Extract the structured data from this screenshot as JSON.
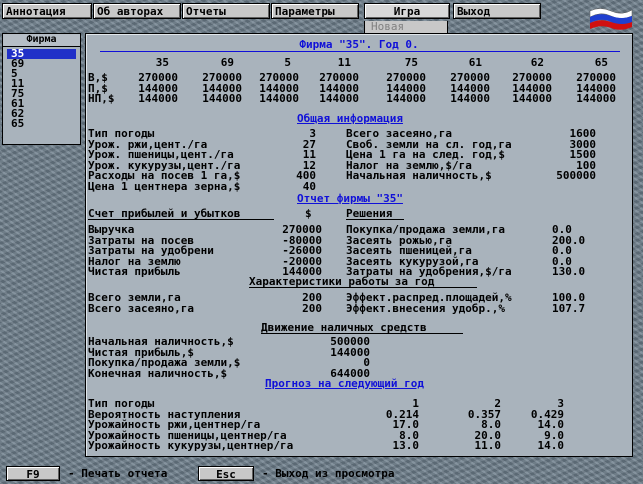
{
  "menu": {
    "items": [
      "Аннотация",
      "Об авторах",
      "Отчеты",
      "Параметры",
      "Игра",
      "Выход"
    ],
    "submenu_new": "Новая"
  },
  "firms": {
    "title": "Фирма",
    "items": [
      "35",
      "69",
      "5",
      "11",
      "75",
      "61",
      "62",
      "65"
    ],
    "selected": "35"
  },
  "report": {
    "title": "Фирма \"35\". Год 0.",
    "firm_columns": [
      "35",
      "69",
      "5",
      "11",
      "75",
      "61",
      "62",
      "65"
    ],
    "firm_rows": [
      {
        "label": "В,$",
        "values": [
          "270000",
          "270000",
          "270000",
          "270000",
          "270000",
          "270000",
          "270000",
          "270000"
        ]
      },
      {
        "label": "П,$",
        "values": [
          "144000",
          "144000",
          "144000",
          "144000",
          "144000",
          "144000",
          "144000",
          "144000"
        ]
      },
      {
        "label": "НП,$",
        "values": [
          "144000",
          "144000",
          "144000",
          "144000",
          "144000",
          "144000",
          "144000",
          "144000"
        ]
      }
    ],
    "general_info": {
      "heading": "Общая информация",
      "left": [
        {
          "label": "Тип погоды",
          "value": "3"
        },
        {
          "label": "Урож. ржи,цент./га",
          "value": "27"
        },
        {
          "label": "Урож. пшеницы,цент./га",
          "value": "11"
        },
        {
          "label": "Урож. кукурузы,цент./га",
          "value": "12"
        },
        {
          "label": "Расходы на посев 1 га,$",
          "value": "400"
        },
        {
          "label": "Цена 1 центнера зерна,$",
          "value": "40"
        }
      ],
      "right": [
        {
          "label": "Всего засеяно,га",
          "value": "1600"
        },
        {
          "label": "Своб. земли на сл. год,га",
          "value": "3000"
        },
        {
          "label": "Цена 1 га на след. год,$",
          "value": "1500"
        },
        {
          "label": "Налог на землю,$/га",
          "value": "100"
        },
        {
          "label": "Начальная наличность,$",
          "value": "500000"
        }
      ]
    },
    "firm_report": {
      "heading": "Отчет фирмы \"35\"",
      "pl_heading": "Счет прибылей и убытков",
      "currency": "$",
      "pl": [
        {
          "label": "Выручка",
          "value": "270000"
        },
        {
          "label": "Затраты на посев",
          "value": "-80000"
        },
        {
          "label": "Затраты на удобрени",
          "value": "-26000"
        },
        {
          "label": "Налог на землю",
          "value": "-20000"
        },
        {
          "label": "Чистая прибыль",
          "value": "144000"
        }
      ],
      "decisions_heading": "Решения",
      "decisions": [
        {
          "label": "Покупка/продажа земли,га",
          "value": "0.0"
        },
        {
          "label": "Засеять рожью,га",
          "value": "200.0"
        },
        {
          "label": "Засеять пшеницей,га",
          "value": "0.0"
        },
        {
          "label": "Засеять кукурузой,га",
          "value": "0.0"
        },
        {
          "label": "Затраты на удобрения,$/га",
          "value": "130.0"
        }
      ]
    },
    "work": {
      "heading": "Характеристики работы за год",
      "left": [
        {
          "label": "Всего земли,га",
          "value": "200"
        },
        {
          "label": "Всего засеяно,га",
          "value": "200"
        }
      ],
      "right": [
        {
          "label": "Эффект.распред.площадей,%",
          "value": "100.0"
        },
        {
          "label": "Эффект.внесения удобр.,%",
          "value": "107.7"
        }
      ]
    },
    "cash": {
      "heading": "Движение наличных средств",
      "rows": [
        {
          "label": "Начальная наличность,$",
          "value": "500000"
        },
        {
          "label": "Чистая прибыль,$",
          "value": "144000"
        },
        {
          "label": "Покупка/продажа земли,$",
          "value": "0"
        },
        {
          "label": "Конечная наличность,$",
          "value": "644000"
        }
      ]
    },
    "forecast": {
      "heading": "Прогноз на следующий год",
      "rows": [
        {
          "label": "Тип погоды",
          "values": [
            "1",
            "2",
            "3"
          ]
        },
        {
          "label": "Вероятность наступления",
          "values": [
            "0.214",
            "0.357",
            "0.429"
          ]
        },
        {
          "label": "Урожайность ржи,центнер/га",
          "values": [
            "17.0",
            "8.0",
            "14.0"
          ]
        },
        {
          "label": "Урожайность пшеницы,центнер/га",
          "values": [
            "8.0",
            "20.0",
            "9.0"
          ]
        },
        {
          "label": "Урожайность кукурузы,центнер/га",
          "values": [
            "13.0",
            "11.0",
            "14.0"
          ]
        }
      ]
    }
  },
  "bottom": {
    "f9_key": "F9",
    "f9_desc": "- Печать отчета",
    "esc_key": "Esc",
    "esc_desc": "- Выход из просмотра"
  },
  "colors": {
    "heading": "#1010d8",
    "panel": "#a9b3bc",
    "selection": "#2030c8"
  }
}
